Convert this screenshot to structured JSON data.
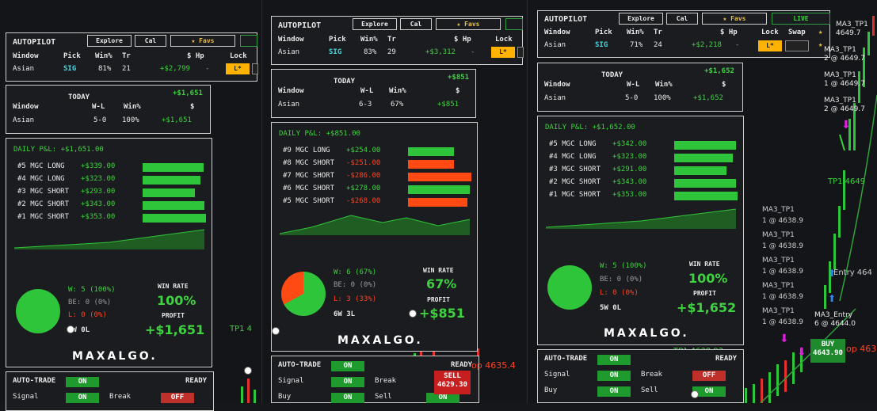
{
  "colors": {
    "green": "#3fd23f",
    "red": "#ff4422",
    "accent": "#ffb300"
  },
  "p1": {
    "header": {
      "title": "AUTOPILOT",
      "explore": "Explore",
      "cal": "Cal",
      "favs": "★ Favs"
    },
    "cols": {
      "window": "Window",
      "pick": "Pick",
      "winpct": "Win%",
      "tr": "Tr",
      "hp": "$ Hp",
      "lock": "Lock"
    },
    "row": {
      "window": "Asian",
      "pick": "SIG",
      "winpct": "81%",
      "tr": "21",
      "hp": "+$2,799",
      "dash": "-",
      "lock": "L*"
    },
    "today": {
      "title": "TODAY",
      "total": "+$1,651",
      "window": "Window",
      "wl": "W-L",
      "winpct": "Win%",
      "dollar": "$",
      "r_window": "Asian",
      "r_wl": "5-0",
      "r_winpct": "100%",
      "r_dollar": "+$1,651"
    },
    "pnl": {
      "title": "DAILY P&L: +$1,651.00",
      "trades": [
        {
          "label": "#5 MGC LONG",
          "val": "+$339.00",
          "fill": 0.96
        },
        {
          "label": "#4 MGC LONG",
          "val": "+$323.00",
          "fill": 0.91
        },
        {
          "label": "#3 MGC SHORT",
          "val": "+$293.00",
          "fill": 0.83
        },
        {
          "label": "#2 MGC SHORT",
          "val": "+$343.00",
          "fill": 0.97
        },
        {
          "label": "#1 MGC SHORT",
          "val": "+$353.00",
          "fill": 1.0
        }
      ],
      "w": "W: 5 (100%)",
      "be": "BE: 0 (0%)",
      "l": "L: 0 (0%)",
      "wl": "5W 0L",
      "winrate_label": "WIN RATE",
      "winrate": "100%",
      "profit_label": "PROFIT",
      "profit": "+$1,651"
    },
    "logo": "MAXALGO.",
    "auto": {
      "title": "AUTO-TRADE",
      "on": "ON",
      "ready": "READY",
      "signal": "Signal",
      "break": "Break",
      "off": "OFF"
    },
    "tp": "TP1 4"
  },
  "p2": {
    "header": {
      "title": "AUTOPILOT",
      "explore": "Explore",
      "cal": "Cal",
      "favs": "★ Favs"
    },
    "cols": {
      "window": "Window",
      "pick": "Pick",
      "winpct": "Win%",
      "tr": "Tr",
      "hp": "$ Hp",
      "lock": "Lock"
    },
    "row": {
      "window": "Asian",
      "pick": "SIG",
      "winpct": "83%",
      "tr": "29",
      "hp": "+$3,312",
      "dash": "-",
      "lock": "L*"
    },
    "today": {
      "title": "TODAY",
      "total": "+$851",
      "window": "Window",
      "wl": "W-L",
      "winpct": "Win%",
      "dollar": "$",
      "r_window": "Asian",
      "r_wl": "6-3",
      "r_winpct": "67%",
      "r_dollar": "+$851"
    },
    "pnl": {
      "title": "DAILY P&L: +$851.00",
      "trades": [
        {
          "label": "#9 MGC LONG",
          "val": "+$254.00",
          "neg": false,
          "fill": 0.72
        },
        {
          "label": "#8 MGC SHORT",
          "val": "-$251.00",
          "neg": true,
          "fill": 0.72
        },
        {
          "label": "#7 MGC SHORT",
          "val": "-$286.00",
          "neg": true,
          "fill": 1.0
        },
        {
          "label": "#6 MGC SHORT",
          "val": "+$278.00",
          "neg": false,
          "fill": 0.98
        },
        {
          "label": "#5 MGC SHORT",
          "val": "-$268.00",
          "neg": true,
          "fill": 0.94
        }
      ],
      "w": "W: 6 (67%)",
      "be": "BE: 0 (0%)",
      "l": "L: 3 (33%)",
      "wl": "6W 3L",
      "winrate_label": "WIN RATE",
      "winrate": "67%",
      "profit_label": "PROFIT",
      "profit": "+$851"
    },
    "logo": "MAXALGO.",
    "auto": {
      "title": "AUTO-TRADE",
      "on": "ON",
      "ready": "READY",
      "signal": "Signal",
      "break": "Break",
      "buy": "Buy",
      "sell": "Sell"
    },
    "sell_tag": "SELL",
    "sell_price": "4629.30",
    "stop": "op 4635.4"
  },
  "p3": {
    "header": {
      "title": "AUTOPILOT",
      "explore": "Explore",
      "cal": "Cal",
      "favs": "★ Favs",
      "live": "LIVE"
    },
    "cols": {
      "window": "Window",
      "pick": "Pick",
      "winpct": "Win%",
      "tr": "Tr",
      "hp": "$ Hp",
      "lock": "Lock",
      "swap": "Swap"
    },
    "row": {
      "window": "Asian",
      "pick": "SIG",
      "winpct": "71%",
      "tr": "24",
      "hp": "+$2,218",
      "dash": "-",
      "lock": "L*"
    },
    "today": {
      "title": "TODAY",
      "total": "+$1,652",
      "window": "Window",
      "wl": "W-L",
      "winpct": "Win%",
      "dollar": "$",
      "r_window": "Asian",
      "r_wl": "5-0",
      "r_winpct": "100%",
      "r_dollar": "+$1,652"
    },
    "pnl": {
      "title": "DAILY P&L: +$1,652.00",
      "trades": [
        {
          "label": "#5 MGC LONG",
          "val": "+$342.00",
          "fill": 0.97
        },
        {
          "label": "#4 MGC LONG",
          "val": "+$323.00",
          "fill": 0.92
        },
        {
          "label": "#3 MGC SHORT",
          "val": "+$291.00",
          "fill": 0.83
        },
        {
          "label": "#2 MGC SHORT",
          "val": "+$343.00",
          "fill": 0.97
        },
        {
          "label": "#1 MGC SHORT",
          "val": "+$353.00",
          "fill": 1.0
        }
      ],
      "w": "W: 5 (100%)",
      "be": "BE: 0 (0%)",
      "l": "L: 0 (0%)",
      "wl": "5W 0L",
      "winrate_label": "WIN RATE",
      "winrate": "100%",
      "profit_label": "PROFIT",
      "profit": "+$1,652"
    },
    "logo": "MAXALGO.",
    "auto": {
      "title": "AUTO-TRADE",
      "on": "ON",
      "ready": "READY",
      "signal": "Signal",
      "break": "Break",
      "off": "OFF",
      "buy": "Buy",
      "sell": "Sell"
    },
    "tp": "TP1 4638.93"
  },
  "chart_right": {
    "labels": [
      {
        "t1": "MA3_TP1",
        "t2": "4649.7"
      },
      {
        "t1": "MA3_TP1",
        "t2": "2 @ 4649.7"
      },
      {
        "t1": "MA3_TP1",
        "t2": "1 @ 4649.7"
      },
      {
        "t1": "MA3_TP1",
        "t2": "2 @ 4649.7"
      }
    ],
    "tp_line": "TP1 4649",
    "left_labels": [
      {
        "t1": "MA3_TP1",
        "t2": "1 @ 4638.9"
      },
      {
        "t1": "MA3_TP1",
        "t2": "1 @ 4638.9"
      },
      {
        "t1": "MA3_TP1",
        "t2": "1 @ 4638.9"
      },
      {
        "t1": "MA3_TP1",
        "t2": "1 @ 4638.9"
      },
      {
        "t1": "MA3_TP1",
        "t2": "1 @ 4638.9"
      }
    ],
    "entry": "Entry 464",
    "ma3_entry": "MA3_Entry",
    "ma3_entry_sub": "6 @ 4644.0",
    "buy": "BUY",
    "buy_price": "4643.90",
    "stop": "op 463"
  }
}
